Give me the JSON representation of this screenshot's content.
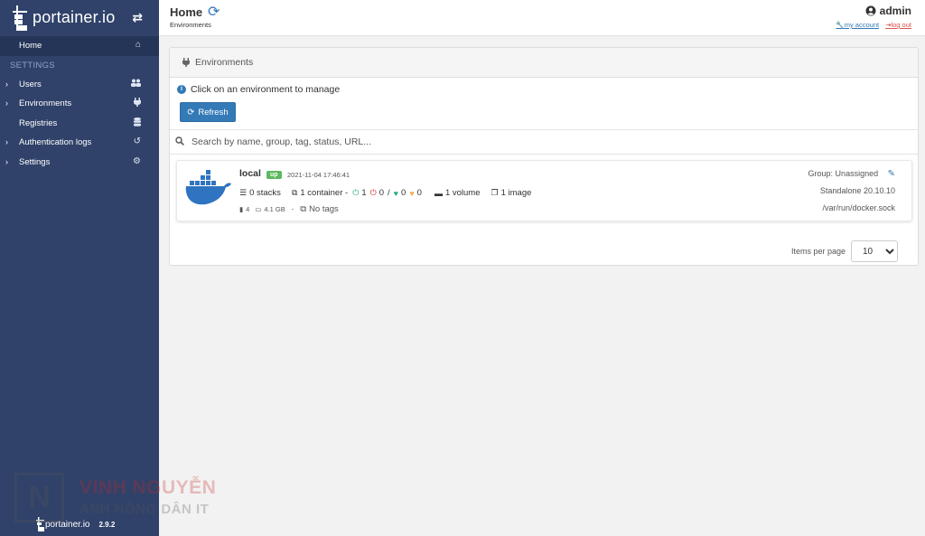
{
  "sidebar": {
    "brand": "portainer.io",
    "home": "Home",
    "section_label": "SETTINGS",
    "items": [
      {
        "label": "Users",
        "expandable": true
      },
      {
        "label": "Environments",
        "expandable": true
      },
      {
        "label": "Registries",
        "expandable": false
      },
      {
        "label": "Authentication logs",
        "expandable": true
      },
      {
        "label": "Settings",
        "expandable": true
      }
    ],
    "footer_brand": "portainer.io",
    "version": "2.9.2"
  },
  "watermark": {
    "line1": "VINH NGUYỄN",
    "line2": "ANH NÔNG DÂN IT"
  },
  "topbar": {
    "title": "Home",
    "breadcrumb": "Environments",
    "user": "admin",
    "my_account": "my account",
    "log_out": "log out"
  },
  "environments": {
    "header": "Environments",
    "info": "Click on an environment to manage",
    "refresh_label": "Refresh",
    "search_placeholder": "Search by name, group, tag, status, URL...",
    "items_per_page_label": "Items per page",
    "items_per_page": "10",
    "items_per_page_options": [
      "10"
    ]
  },
  "env_card": {
    "name": "local",
    "status": "up",
    "timestamp": "2021-11-04 17:46:41",
    "stacks": "0 stacks",
    "containers": "1 container -",
    "running": "1",
    "stopped": "0",
    "separator": "/",
    "healthy": "0",
    "unhealthy": "0",
    "volumes": "1 volume",
    "images": "1 image",
    "cpu": "4",
    "memory": "4.1 GB",
    "dash": "-",
    "tags": "No tags",
    "group": "Group: Unassigned",
    "type": "Standalone 20.10.10",
    "url": "/var/run/docker.sock"
  },
  "colors": {
    "sidebar_bg": "#30426a",
    "primary": "#337ab7",
    "success": "#5cb85c",
    "danger": "#c9302c"
  }
}
